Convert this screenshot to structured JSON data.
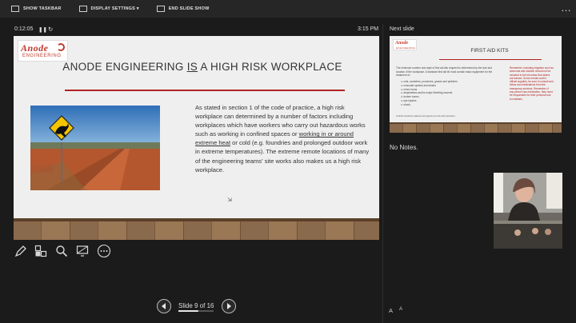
{
  "toolbar": {
    "show_taskbar": "SHOW TASKBAR",
    "display_settings": "DISPLAY SETTINGS ▾",
    "end_slide_show": "END SLIDE SHOW"
  },
  "status": {
    "timer": "0:12:05",
    "clock": "3:15 PM"
  },
  "slide": {
    "logo_line1": "Anode",
    "logo_line2": "ENGINEERING",
    "title": "ANODE ENGINEERING IS A HIGH RISK WORKPLACE",
    "body_before": "As stated in section 1 of the code of practice, a high risk workplace can determined by a number of factors including workplaces which have workers who carry out hazardous works such as working in confined spaces or ",
    "body_underlined": "working in or around extreme heat",
    "body_after": " or cold (e.g. foundries and prolonged outdoor work in extreme temperatures). The extreme remote locations of many of the engineering teams' site works also makes us a high risk workplace."
  },
  "navigation": {
    "label": "Slide 9 of 16",
    "progress": 0.5625
  },
  "next_panel": {
    "title": "Next slide",
    "slide_title": "FIRST AID KITS",
    "intro": "The minimum number and style of first aid kits required is determined by the size and location of the workplace. A standard first aid kit must contain basic equipment for the treatment of:",
    "items": [
      "cuts, scratches, punctures, grazes and splinters",
      "muscular sprains and strains",
      "minor burns",
      "amputations and/or major bleeding wounds",
      "broken bones",
      "eye injuries",
      "shock."
    ],
    "side_note": "Remember, including irrigation such as ammonia and solution should not be included in the kit unless first aiders are trained. Some remote work's official supplies, be sure to consult and follow and medications from the emergency services. Remember, if any person has medication, they must be responsible for their personal use to maintain.",
    "footnote": "A full kit should be retained and topped up in line with instruction.",
    "notes": "No Notes."
  },
  "font_controls": [
    "A",
    "A"
  ],
  "colors": {
    "title_rule": "#b22222",
    "logo_red": "#c0392b"
  }
}
